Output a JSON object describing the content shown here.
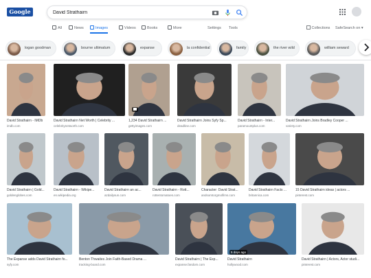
{
  "header": {
    "logo_text": "Google",
    "query": "David Strathairn"
  },
  "tabs": [
    {
      "label": "All",
      "icon": "search-icon",
      "active": false
    },
    {
      "label": "News",
      "icon": "news-icon",
      "active": false
    },
    {
      "label": "Images",
      "icon": "image-icon",
      "active": true
    },
    {
      "label": "Videos",
      "icon": "video-icon",
      "active": false
    },
    {
      "label": "Books",
      "icon": "book-icon",
      "active": false
    },
    {
      "label": "More",
      "icon": "more-icon",
      "active": false
    }
  ],
  "tools": {
    "settings": "Settings",
    "tools": "Tools",
    "collections": "Collections",
    "safesearch": "SafeSearch on ▾"
  },
  "chips": [
    "logan goodman",
    "bourne ultimatum",
    "expanse",
    "la confidential",
    "family",
    "the river wild",
    "william seward"
  ],
  "images": [
    {
      "caption": "David Strathairn - IMDb",
      "source": "imdb.com"
    },
    {
      "caption": "David Strathairn Net Worth | Celebrity ...",
      "source": "celebritynetworth.com"
    },
    {
      "caption": "1,234 David Strathairn ...",
      "source": "gettyimages.com"
    },
    {
      "caption": "David Strathairn Joins Syfy Sp...",
      "source": "deadline.com"
    },
    {
      "caption": "David Strathairn - Inter...",
      "source": "paramountplus.com"
    },
    {
      "caption": "David Strathairn Joins Bradley Cooper ...",
      "source": "variety.com"
    },
    {
      "caption": "David Strathairn | Gold...",
      "source": "goldenglobes.com"
    },
    {
      "caption": "David Strathairn - Wikipe...",
      "source": "en.wikipedia.org"
    },
    {
      "caption": "David Strathairn an ac...",
      "source": "azdailysun.com"
    },
    {
      "caption": "David Strathairn - Rott...",
      "source": "rottentomatoes.com"
    },
    {
      "caption": "Character: David Strat...",
      "source": "andsomtorgmofilms.com"
    },
    {
      "caption": "David Strathairn Facts ...",
      "source": "britannica.com"
    },
    {
      "caption": "15 David Strathairn ideas | actors ...",
      "source": "pinterest.com"
    },
    {
      "caption": "The Expanse adds David Strathairn fo...",
      "source": "syfy.com"
    },
    {
      "caption": "Benton Thwaites Join Faith-Based Drama ...",
      "source": "tracking-board.com"
    },
    {
      "caption": "David Strathairn | The Exp...",
      "source": "expanse.fandom.com"
    },
    {
      "caption": "David Strathairn",
      "source": "hollywood.com"
    },
    {
      "caption": "David Strathairn | Actors, Actor studi...",
      "source": "pinterest.com"
    }
  ],
  "tags": {
    "days_ago": "5 days ago"
  }
}
